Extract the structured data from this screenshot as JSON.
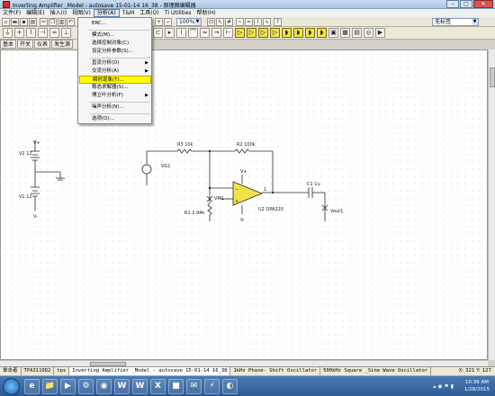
{
  "window": {
    "title": "Inverting Amplifier _Model - autosave 15-01-14 16_38 - 原理图编辑器",
    "btn_min": "–",
    "btn_max": "□",
    "btn_close": "✕"
  },
  "menu": [
    "文件(F)",
    "编辑(E)",
    "插入(I)",
    "视图(V)",
    "分析(A)",
    "T&M",
    "工具(O)",
    "TI Utilities",
    "帮助(H)"
  ],
  "toolbar": {
    "zoom": "100%",
    "combo_right": "无标签",
    "small_combo": ""
  },
  "component_tabs": [
    "基本",
    "开关",
    "仪表",
    "发生源"
  ],
  "analysis_menu": {
    "items": [
      {
        "label": "ERC...",
        "submenu": false
      },
      {
        "label": "模式(M)...",
        "submenu": false
      },
      {
        "label": "选择控制对象(C)",
        "submenu": false
      },
      {
        "label": "设定分析参数(S)...",
        "submenu": false
      },
      {
        "label": "直流分析(D)",
        "submenu": true
      },
      {
        "label": "交流分析(A)",
        "submenu": true
      },
      {
        "label": "瞬时现象(T)...",
        "submenu": false,
        "highlighted": true
      },
      {
        "label": "稳态求解器(S)...",
        "submenu": false
      },
      {
        "label": "傅立叶分析(F)",
        "submenu": true
      },
      {
        "label": "噪声分析(N)...",
        "submenu": false
      },
      {
        "label": "选项(O)...",
        "submenu": false
      }
    ]
  },
  "schematic": {
    "v2_label": "V2 12",
    "v1_label": "V1 12",
    "vplus_label": "V+",
    "vminus_label": "V-",
    "r3_label": "R3 10k",
    "r2_label": "R2 100k",
    "r1_label": "R1 2.94k",
    "vg1_label": "VG1",
    "vm1_label": "VM1",
    "u2_label": "U2 OPA220",
    "c1_label": "C1 1u",
    "vout_label": "Vout1",
    "pin_plus": "+",
    "pin_minus": "−",
    "pin_1": "1"
  },
  "status_tabs": [
    "单击者",
    "TPA3110D2",
    "tps",
    "Inverting Amplifier _Model - autosave 15-01-14 16_38",
    "1kHz Phase- Shift Oscillator",
    "500kHz Square _Sine Wave Oscillator"
  ],
  "coords": "X: 321  Y: 127",
  "taskbar": {
    "apps": [
      "e",
      "📁",
      "▶",
      "⚙",
      "◉",
      "W",
      "W",
      "X",
      "■",
      "✉",
      "⚡",
      "◐"
    ],
    "time": "10:36 AM",
    "date": "1/28/2015"
  },
  "colors": {
    "opamp_fill": "#f2e24a",
    "wire": "#2a2a2a",
    "menu_highlight": "#ffff00",
    "title_gradient": "#a9c6e6"
  }
}
